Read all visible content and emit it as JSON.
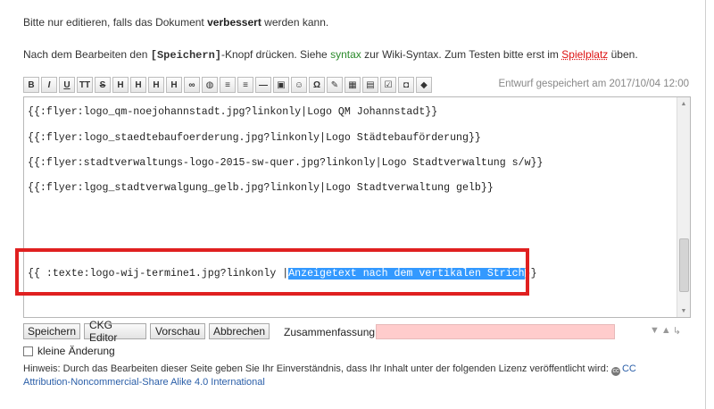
{
  "intro": {
    "pre": "Bitte nur editieren, falls das Dokument ",
    "bold": "verbessert",
    "post": " werden kann."
  },
  "help": {
    "pre": "Nach dem Bearbeiten den ",
    "kbd": "[Speichern]",
    "mid": "-Knopf drücken. Siehe ",
    "syntax_link": "syntax",
    "mid2": " zur Wiki-Syntax. Zum Testen bitte erst im ",
    "playground_link": "Spielplatz",
    "post": " üben."
  },
  "toolbar": {
    "buttons": [
      {
        "name": "bold-button",
        "glyph": "B"
      },
      {
        "name": "italic-button",
        "glyph": "I"
      },
      {
        "name": "underline-button",
        "glyph": "U"
      },
      {
        "name": "monospace-button",
        "glyph": "TT"
      },
      {
        "name": "strikethrough-button",
        "glyph": "S"
      },
      {
        "name": "heading-same-button",
        "glyph": "H"
      },
      {
        "name": "heading-lower-button",
        "glyph": "H"
      },
      {
        "name": "heading-higher-button",
        "glyph": "H"
      },
      {
        "name": "heading-menu-button",
        "glyph": "H"
      },
      {
        "name": "link-button",
        "glyph": "∞"
      },
      {
        "name": "external-link-button",
        "glyph": "◍"
      },
      {
        "name": "ordered-list-button",
        "glyph": "≡"
      },
      {
        "name": "unordered-list-button",
        "glyph": "≡"
      },
      {
        "name": "horizontal-rule-button",
        "glyph": "—"
      },
      {
        "name": "image-button",
        "glyph": "▣"
      },
      {
        "name": "smiley-button",
        "glyph": "☺"
      },
      {
        "name": "special-chars-button",
        "glyph": "Ω"
      },
      {
        "name": "signature-button",
        "glyph": "✎"
      },
      {
        "name": "table-button",
        "glyph": "▦"
      },
      {
        "name": "note-button",
        "glyph": "▤"
      },
      {
        "name": "checkbox-button",
        "glyph": "☑"
      },
      {
        "name": "package-button",
        "glyph": "◘"
      },
      {
        "name": "plugin-button",
        "glyph": "◆"
      }
    ]
  },
  "draft_status": "Entwurf gespeichert am 2017/10/04 12:00",
  "editor": {
    "lines": [
      "{{:flyer:logo_qm-noejohannstadt.jpg?linkonly|Logo QM Johannstadt}}",
      "{{:flyer:logo_staedtebaufoerderung.jpg?linkonly|Logo Städtebauförderung}}",
      "{{:flyer:stadtverwaltungs-logo-2015-sw-quer.jpg?linkonly|Logo Stadtverwaltung s/w}}",
      "{{:flyer:lgog_stadtverwalgung_gelb.jpg?linkonly|Logo Stadtverwaltung gelb}}"
    ],
    "focus_line": {
      "pre": "{{ :texte:logo-wij-termine1.jpg?linkonly |",
      "selected": "Anzeigetext nach dem vertikalen Strich",
      "post": "}}"
    }
  },
  "buttons": {
    "save": "Speichern",
    "ckg": "CKG Editor",
    "preview": "Vorschau",
    "cancel": "Abbrechen"
  },
  "summary": {
    "label": "Zusammenfassung",
    "value": ""
  },
  "minor_change": {
    "label": "kleine Änderung",
    "checked": false
  },
  "license": {
    "text": "Hinweis: Durch das Bearbeiten dieser Seite geben Sie Ihr Einverständnis, dass Ihr Inhalt unter der folgenden Lizenz veröffentlicht wird: ",
    "link": "CC Attribution-Noncommercial-Share Alike 4.0 International"
  },
  "colors": {
    "highlight": "#3399ff",
    "annotation_box": "#e02020",
    "summary_empty": "#ffcccc"
  }
}
